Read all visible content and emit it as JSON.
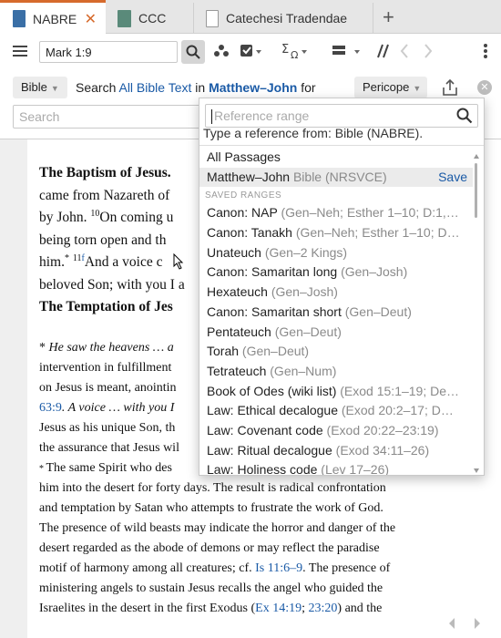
{
  "tabs": [
    {
      "label": "NABRE",
      "close": "✕"
    },
    {
      "label": "CCC"
    },
    {
      "label": "Catechesi Tradendae"
    }
  ],
  "new_tab_label": "+",
  "toolbar": {
    "reference": "Mark 1:9"
  },
  "search": {
    "bible_button": "Bible",
    "prefix": "Search",
    "scope": "All Bible Text",
    "in_word": "in",
    "range": "Matthew–John",
    "for_word": "for",
    "pericope_button": "Pericope",
    "placeholder": "Search"
  },
  "document": {
    "heading1": "The Baptism of Jesus.",
    "p1": [
      "came from Nazareth of",
      "by John. ",
      "being torn open and th",
      "him.",
      "beloved Son; with you I a"
    ],
    "v10": "10",
    "v10_text": "On coming u",
    "v11": "11",
    "v11_text": "And a voice c",
    "heading2": "The Temptation of Jes",
    "notes": [
      {
        "pre": "* ",
        "italic": "He saw the heavens … a",
        "rest": ""
      },
      {
        "pre": "",
        "italic": "",
        "rest": "intervention in fulfillment"
      },
      {
        "pre": "",
        "italic": "",
        "rest": "on Jesus is meant, anointin"
      },
      {
        "ref": "63:9",
        "italic": ". A voice … with you I",
        "rest": ""
      },
      {
        "pre": "",
        "italic": "",
        "rest": "Jesus as his unique Son, th"
      },
      {
        "pre": "",
        "italic": "",
        "rest": "the assurance that Jesus wil"
      },
      {
        "pre": "* ",
        "italic": "",
        "rest": "The same Spirit who des"
      },
      {
        "pre": "",
        "italic": "",
        "rest": "him into the desert for forty days. The result is radical confrontation"
      },
      {
        "pre": "",
        "italic": "",
        "rest": "and temptation by Satan who attempts to frustrate the work of God."
      },
      {
        "pre": "",
        "italic": "",
        "rest": "The presence of wild beasts may indicate the horror and danger of the"
      },
      {
        "pre": "",
        "italic": "",
        "rest": "desert regarded as the abode of demons or may reflect the paradise"
      },
      {
        "pre": "",
        "italic": "",
        "rest": "motif of harmony among all creatures; cf. "
      },
      {
        "pre": "",
        "italic": "",
        "rest": "ministering angels to sustain Jesus recalls the angel who guided the"
      },
      {
        "pre": "",
        "italic": "",
        "rest": "Israelites in the desert in the first Exodus ("
      }
    ],
    "ref_is": "Is 11:6–9",
    "after_is": ". The presence of",
    "ref_ex1": "Ex 14:19",
    "ref_sep": "; ",
    "ref_ex2": "23:20",
    "after_ex": ") and the"
  },
  "dropdown": {
    "placeholder": "Reference range",
    "hint": "Type a reference from: Bible (NABRE).",
    "all_passages": "All Passages",
    "selected_label": "Matthew–John",
    "selected_source": "Bible (NRSVCE)",
    "save_label": "Save",
    "section_label": "SAVED RANGES",
    "items": [
      {
        "name": "Canon: NAP",
        "range": "(Gen–Neh; Esther 1–10; D:1,…"
      },
      {
        "name": "Canon: Tanakh",
        "range": "(Gen–Neh; Esther 1–10; D…"
      },
      {
        "name": "Unateuch",
        "range": "(Gen–2 Kings)"
      },
      {
        "name": "Canon: Samaritan long",
        "range": "(Gen–Josh)"
      },
      {
        "name": "Hexateuch",
        "range": "(Gen–Josh)"
      },
      {
        "name": "Canon: Samaritan short",
        "range": "(Gen–Deut)"
      },
      {
        "name": "Pentateuch",
        "range": "(Gen–Deut)"
      },
      {
        "name": "Torah",
        "range": "(Gen–Deut)"
      },
      {
        "name": "Tetrateuch",
        "range": "(Gen–Num)"
      },
      {
        "name": "Book of Odes (wiki list)",
        "range": "(Exod 15:1–19; De…"
      },
      {
        "name": "Law: Ethical decalogue",
        "range": "(Exod 20:2–17; D…"
      },
      {
        "name": "Law: Covenant code",
        "range": "(Exod 20:22–23:19)"
      },
      {
        "name": "Law: Ritual decalogue",
        "range": "(Exod 34:11–26)"
      },
      {
        "name": "Law: Holiness code",
        "range": "(Lev 17–26)"
      }
    ]
  },
  "colors": {
    "accent": "#d66a2c",
    "link": "#1a5aa6"
  }
}
